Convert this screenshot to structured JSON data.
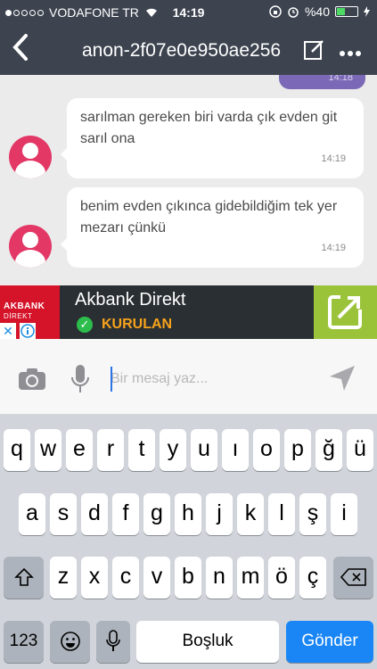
{
  "status": {
    "carrier": "VODAFONE TR",
    "time": "14:19",
    "battery": "%40"
  },
  "nav": {
    "title": "anon-2f07e0e950ae256"
  },
  "chat": {
    "prev_time": "14:18",
    "messages": [
      {
        "text": "sarılman gereken biri varda çık evden git sarıl ona",
        "time": "14:19"
      },
      {
        "text": "benim evden çıkınca gidebildiğim tek yer mezarı çünkü",
        "time": "14:19"
      }
    ]
  },
  "ad": {
    "logo_line1": "AKBANK",
    "logo_line2": "DİREKT",
    "headline": "Akbank Direkt",
    "cta": "KURULAN",
    "close": "✕"
  },
  "composer": {
    "placeholder": "Bir mesaj yaz..."
  },
  "keyboard": {
    "row1": [
      "q",
      "w",
      "e",
      "r",
      "t",
      "y",
      "u",
      "ı",
      "o",
      "p",
      "ğ",
      "ü"
    ],
    "row2": [
      "a",
      "s",
      "d",
      "f",
      "g",
      "h",
      "j",
      "k",
      "l",
      "ş",
      "i"
    ],
    "row3": [
      "z",
      "x",
      "c",
      "v",
      "b",
      "n",
      "m",
      "ö",
      "ç"
    ],
    "numbers": "123",
    "space": "Boşluk",
    "send": "Gönder"
  }
}
